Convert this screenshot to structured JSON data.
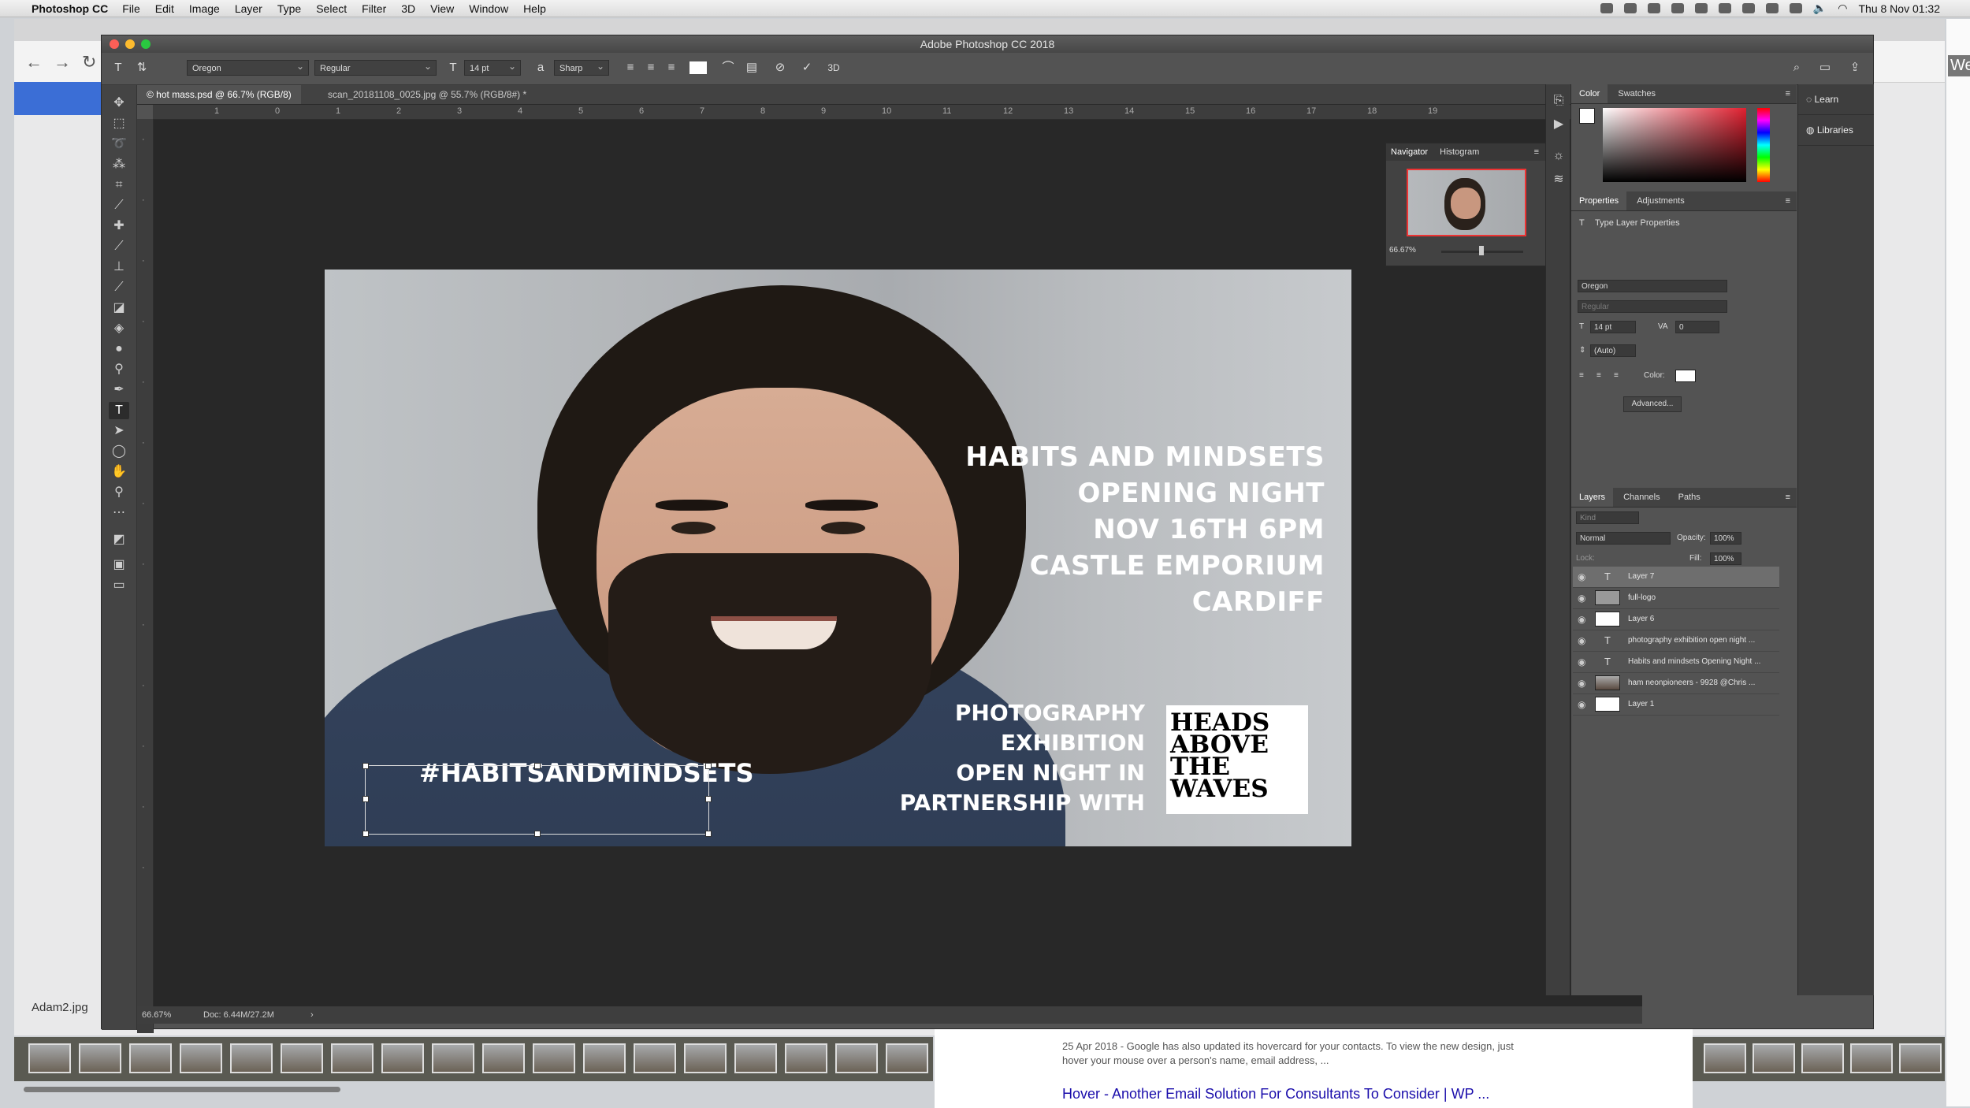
{
  "menubar": {
    "apple": "",
    "app": "Photoshop CC",
    "items": [
      "File",
      "Edit",
      "Image",
      "Layer",
      "Type",
      "Select",
      "Filter",
      "3D",
      "View",
      "Window",
      "Help"
    ],
    "clock": "Thu 8 Nov  01:32"
  },
  "window_title": "Adobe Photoshop CC 2018",
  "options": {
    "font_family": "Oregon",
    "font_style": "Regular",
    "font_size": "14 pt",
    "antialias": "Sharp",
    "three_d": "3D"
  },
  "doc_tabs": [
    {
      "label": "© hot mass.psd @ 66.7% (RGB/8)"
    },
    {
      "label": "scan_20181108_0025.jpg @ 55.7% (RGB/8#) *"
    }
  ],
  "ruler": [
    "1",
    "0",
    "1",
    "2",
    "3",
    "4",
    "5",
    "6",
    "7",
    "8",
    "9",
    "10",
    "11",
    "12",
    "13",
    "14",
    "15",
    "16",
    "17",
    "18",
    "19"
  ],
  "status": {
    "zoom": "66.67%",
    "doc": "Doc: 6.44M/27.2M"
  },
  "navigator": {
    "tab1": "Navigator",
    "tab2": "Histogram",
    "zoom": "66.67%"
  },
  "poster": {
    "lines": [
      "HABITS AND MINDSETS",
      "OPENING NIGHT",
      "NOV 16TH    6PM",
      "CASTLE EMPORIUM",
      "CARDIFF"
    ],
    "sub": [
      "PHOTOGRAPHY",
      "EXHIBITION",
      "OPEN NIGHT IN",
      "PARTNERSHIP WITH"
    ],
    "logo": [
      "HEADS",
      "ABOVE",
      "THE",
      "WAVES"
    ],
    "hashtag": "#HABITSANDMINDSETS"
  },
  "color_panel": {
    "tab1": "Color",
    "tab2": "Swatches"
  },
  "properties": {
    "tab1": "Properties",
    "tab2": "Adjustments",
    "title": "Type Layer Properties",
    "font": "Oregon",
    "style": "Regular",
    "size": "14 pt",
    "tracking": "0",
    "leading": "(Auto)",
    "color_label": "Color:",
    "advanced": "Advanced..."
  },
  "layers_panel": {
    "tabs": [
      "Layers",
      "Channels",
      "Paths"
    ],
    "kind": "Kind",
    "blend": "Normal",
    "opacity_label": "Opacity:",
    "opacity": "100%",
    "lock_label": "Lock:",
    "fill_label": "Fill:",
    "fill": "100%",
    "layers": [
      {
        "name": "Layer 7",
        "type": "text",
        "selected": true
      },
      {
        "name": "full-logo",
        "type": "image"
      },
      {
        "name": "Layer 6",
        "type": "blank"
      },
      {
        "name": "photography  exhibition  open night ...",
        "type": "text"
      },
      {
        "name": "Habits and mindsets Opening Night ...",
        "type": "text"
      },
      {
        "name": "ham neonpioneers - 9928 @Chris ...",
        "type": "image"
      },
      {
        "name": "Layer 1",
        "type": "blank"
      }
    ]
  },
  "learn": [
    "Learn",
    "Libraries"
  ],
  "background": {
    "web": "Web",
    "file": "Adam2.jpg",
    "google_date": "25 Apr 2018 - Google has also updated its hovercard for your contacts. To view the new design, just",
    "google_line2": "hover your mouse over a person's name, email address, ...",
    "google_heading": "Hover - Another Email Solution For Consultants To Consider | WP ..."
  },
  "colors": {
    "accent": "#3b6ed6",
    "ps_bg": "#535353",
    "canvas": "#282828",
    "thumb_border": "#e33333"
  }
}
